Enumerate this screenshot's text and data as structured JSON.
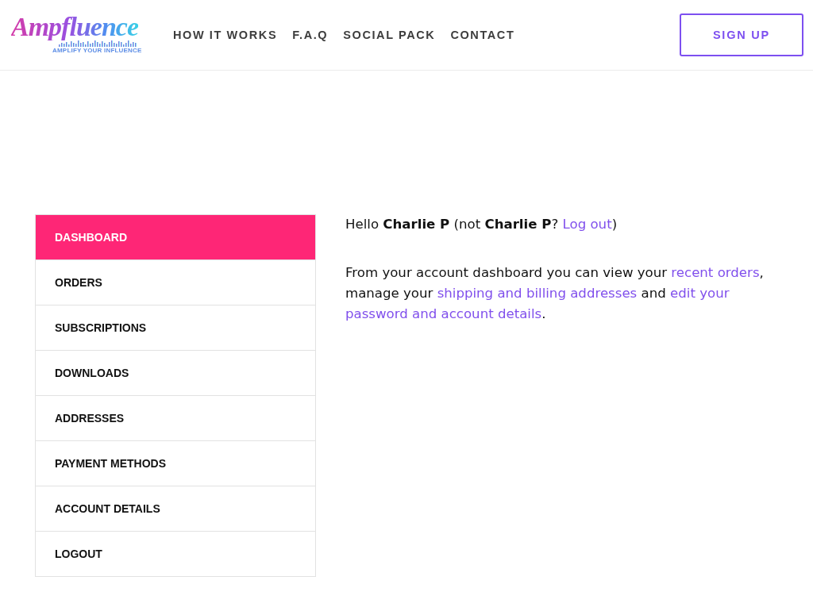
{
  "header": {
    "logo": {
      "wordmark": "Ampfluence",
      "tagline": "AMPLIFY YOUR INFLUENCE"
    },
    "nav": [
      "HOW IT WORKS",
      "F.A.Q",
      "SOCIAL PACK",
      "CONTACT"
    ],
    "signup_button": "SIGN UP"
  },
  "account_menu": [
    {
      "label": "DASHBOARD",
      "selected": true
    },
    {
      "label": "ORDERS",
      "selected": false
    },
    {
      "label": "SUBSCRIPTIONS",
      "selected": false
    },
    {
      "label": "DOWNLOADS",
      "selected": false
    },
    {
      "label": "ADDRESSES",
      "selected": false
    },
    {
      "label": "PAYMENT METHODS",
      "selected": false
    },
    {
      "label": "ACCOUNT DETAILS",
      "selected": false
    },
    {
      "label": "LOGOUT",
      "selected": false
    }
  ],
  "content": {
    "greeting": [
      {
        "kind": "text",
        "text": "Hello **Charlie P** (not **Charlie P**? "
      },
      {
        "kind": "link",
        "text": "Log out"
      },
      {
        "kind": "text",
        "text": ")"
      }
    ],
    "intro": [
      {
        "kind": "text",
        "text": "From your account dashboard you can view your "
      },
      {
        "kind": "link",
        "text": "recent orders"
      },
      {
        "kind": "text",
        "text": ", manage your "
      },
      {
        "kind": "link",
        "text": "shipping and billing addresses"
      },
      {
        "kind": "text",
        "text": " and "
      },
      {
        "kind": "link",
        "text": "edit your"
      },
      {
        "kind": "link",
        "text": "password and account details"
      },
      {
        "kind": "text",
        "text": "."
      }
    ]
  }
}
